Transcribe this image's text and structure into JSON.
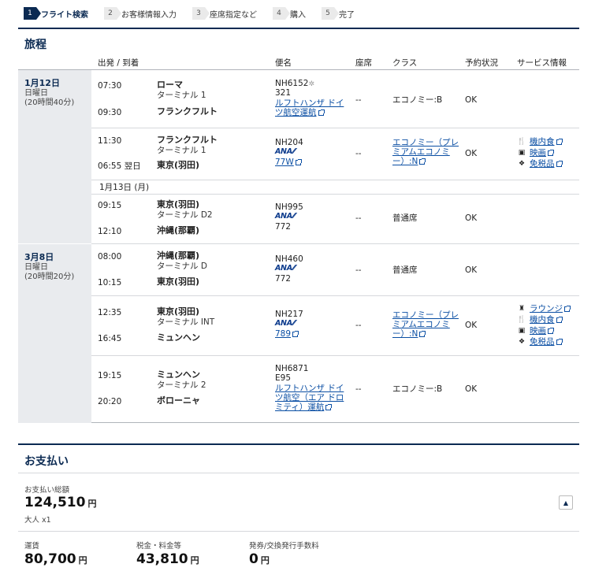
{
  "steps": [
    {
      "num": "1",
      "label": "フライト検索",
      "active": true
    },
    {
      "num": "2",
      "label": "お客様情報入力"
    },
    {
      "num": "3",
      "label": "座席指定など"
    },
    {
      "num": "4",
      "label": "購入"
    },
    {
      "num": "5",
      "label": "完了"
    }
  ],
  "itinerary": {
    "title": "旅程",
    "headers": {
      "dep_arr": "出発 / 到着",
      "flight": "便名",
      "seat": "座席",
      "class": "クラス",
      "status": "予約状況",
      "service": "サービス情報"
    },
    "day1": {
      "date": "1月12日",
      "weekday": "日曜日",
      "duration": "(20時間40分)"
    },
    "day2": {
      "date": "3月8日",
      "weekday": "日曜日",
      "duration": "(20時間20分)"
    },
    "date_separator": "1月13日 (月)",
    "segments": [
      {
        "dep_time": "07:30",
        "dep_city": "ローマ",
        "dep_term": "ターミナル 1",
        "arr_time": "09:30",
        "arr_city": "フランクフルト",
        "flight": "NH6152",
        "aircraft": "321",
        "operator": "ルフトハンザ ドイツ航空運航",
        "seat": "--",
        "class": "エコノミー:B",
        "status": "OK"
      },
      {
        "dep_time": "11:30",
        "dep_city": "フランクフルト",
        "dep_term": "ターミナル 1",
        "arr_time": "06:55 翌日",
        "arr_city": "東京(羽田)",
        "flight": "NH204",
        "airline": "ANA",
        "aircraft": "77W",
        "seat": "--",
        "class": "エコノミー（プレミアムエコノミー）:N",
        "status": "OK",
        "services": [
          "機内食",
          "映画",
          "免税品"
        ]
      },
      {
        "dep_time": "09:15",
        "dep_city": "東京(羽田)",
        "dep_term": "ターミナル D2",
        "arr_time": "12:10",
        "arr_city": "沖縄(那覇)",
        "flight": "NH995",
        "airline": "ANA",
        "aircraft": "772",
        "seat": "--",
        "class": "普通席",
        "status": "OK"
      },
      {
        "dep_time": "08:00",
        "dep_city": "沖縄(那覇)",
        "dep_term": "ターミナル D",
        "arr_time": "10:15",
        "arr_city": "東京(羽田)",
        "flight": "NH460",
        "airline": "ANA",
        "aircraft": "772",
        "seat": "--",
        "class": "普通席",
        "status": "OK"
      },
      {
        "dep_time": "12:35",
        "dep_city": "東京(羽田)",
        "dep_term": "ターミナル INT",
        "arr_time": "16:45",
        "arr_city": "ミュンヘン",
        "flight": "NH217",
        "airline": "ANA",
        "aircraft": "789",
        "seat": "--",
        "class": "エコノミー（プレミアムエコノミー）:N",
        "status": "OK",
        "services": [
          "ラウンジ",
          "機内食",
          "映画",
          "免税品"
        ]
      },
      {
        "dep_time": "19:15",
        "dep_city": "ミュンヘン",
        "dep_term": "ターミナル 2",
        "arr_time": "20:20",
        "arr_city": "ボローニャ",
        "flight": "NH6871",
        "aircraft": "E95",
        "operator": "ルフトハンザ ドイツ航空（エア ドロミティ）運航",
        "seat": "--",
        "class": "エコノミー:B",
        "status": "OK"
      }
    ]
  },
  "payment": {
    "title": "お支払い",
    "total_label": "お支払い総額",
    "total": "124,510",
    "yen": "円",
    "pax": "大人 x1",
    "fare_label": "運賃",
    "fare": "80,700",
    "tax_label": "税金・料金等",
    "tax": "43,810",
    "fee_label": "発券/交換発行手数料",
    "fee": "0"
  },
  "colors": {
    "navy": "#0b2a52",
    "link": "#0a4ea3",
    "day_bg": "#e9ebee"
  }
}
